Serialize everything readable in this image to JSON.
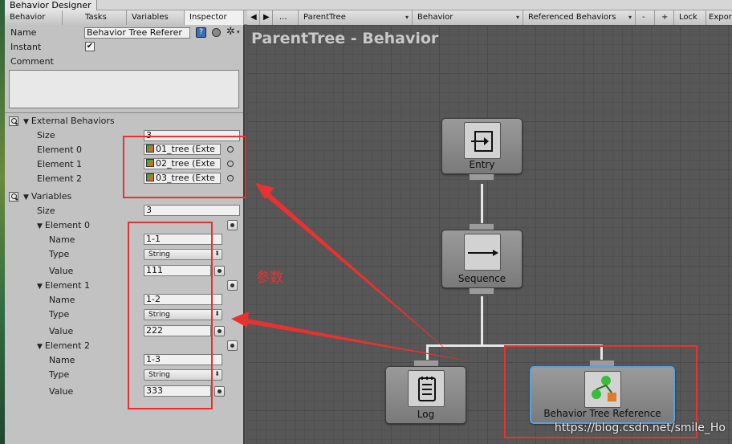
{
  "window": {
    "title": "Behavior Designer"
  },
  "tabs": [
    {
      "label": "Behavior"
    },
    {
      "label": "Tasks"
    },
    {
      "label": "Variables"
    },
    {
      "label": "Inspector"
    }
  ],
  "toolbar": {
    "nav_back": "◀",
    "nav_forward": "▶",
    "more": "...",
    "tree_select": "ParentTree",
    "behavior_select": "Behavior",
    "referenced_select": "Referenced Behaviors",
    "minus": "-",
    "plus": "+",
    "lock": "Lock",
    "export": "Expor"
  },
  "inspector": {
    "name_label": "Name",
    "name_value": "Behavior Tree Referer",
    "instant_label": "Instant",
    "instant_checked": true,
    "comment_label": "Comment",
    "external": {
      "label": "External Behaviors",
      "size_label": "Size",
      "size_value": "3",
      "elements": [
        {
          "label": "Element 0",
          "value": "01_tree (Exte"
        },
        {
          "label": "Element 1",
          "value": "02_tree (Exte"
        },
        {
          "label": "Element 2",
          "value": "03_tree (Exte"
        }
      ]
    },
    "variables": {
      "label": "Variables",
      "size_label": "Size",
      "size_value": "3",
      "name_label": "Name",
      "type_label": "Type",
      "value_label": "Value",
      "elements": [
        {
          "label": "Element 0",
          "name": "1-1",
          "type": "String",
          "value": "111"
        },
        {
          "label": "Element 1",
          "name": "1-2",
          "type": "String",
          "value": "222"
        },
        {
          "label": "Element 2",
          "name": "1-3",
          "type": "String",
          "value": "333"
        }
      ]
    }
  },
  "canvas": {
    "title": "ParentTree - Behavior",
    "nodes": {
      "entry": "Entry",
      "sequence": "Sequence",
      "log": "Log",
      "reference": "Behavior Tree Reference"
    }
  },
  "annotation": {
    "text": "参数"
  },
  "watermark": "https://blog.csdn.net/smile_Ho",
  "colors": {
    "annotation_red": "#e8322f",
    "selection_blue": "#5aa0df"
  }
}
